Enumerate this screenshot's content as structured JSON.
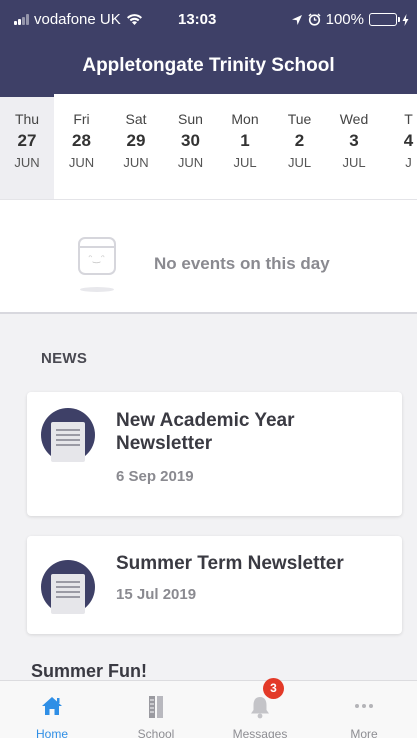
{
  "status_bar": {
    "carrier": "vodafone UK",
    "time": "13:03",
    "battery": "100%",
    "battery_color": "#4cd964"
  },
  "header": {
    "title": "Appletongate Trinity School"
  },
  "theme": {
    "primary": "#3e4067",
    "accent": "#2f8fe6",
    "badge": "#e33a28"
  },
  "dates": [
    {
      "dow": "Thu",
      "num": "27",
      "mon": "JUN",
      "selected": true
    },
    {
      "dow": "Fri",
      "num": "28",
      "mon": "JUN"
    },
    {
      "dow": "Sat",
      "num": "29",
      "mon": "JUN"
    },
    {
      "dow": "Sun",
      "num": "30",
      "mon": "JUN"
    },
    {
      "dow": "Mon",
      "num": "1",
      "mon": "JUL"
    },
    {
      "dow": "Tue",
      "num": "2",
      "mon": "JUL"
    },
    {
      "dow": "Wed",
      "num": "3",
      "mon": "JUL"
    },
    {
      "dow": "T",
      "num": "4",
      "mon": "J"
    }
  ],
  "events": {
    "empty_message": "No events on this day",
    "icon": "calendar-face-icon"
  },
  "news": {
    "heading": "NEWS",
    "items": [
      {
        "title": "New Academic Year Newsletter",
        "date": "6 Sep 2019",
        "icon": "document-icon"
      },
      {
        "title": "Summer Term Newsletter",
        "date": "15 Jul 2019",
        "icon": "document-icon"
      }
    ]
  },
  "next_section": {
    "title": "Summer Fun!"
  },
  "tabs": [
    {
      "label": "Home",
      "icon": "home-icon",
      "active": true
    },
    {
      "label": "School",
      "icon": "school-icon"
    },
    {
      "label": "Messages",
      "icon": "bell-icon",
      "badge": "3"
    },
    {
      "label": "More",
      "icon": "more-icon"
    }
  ]
}
